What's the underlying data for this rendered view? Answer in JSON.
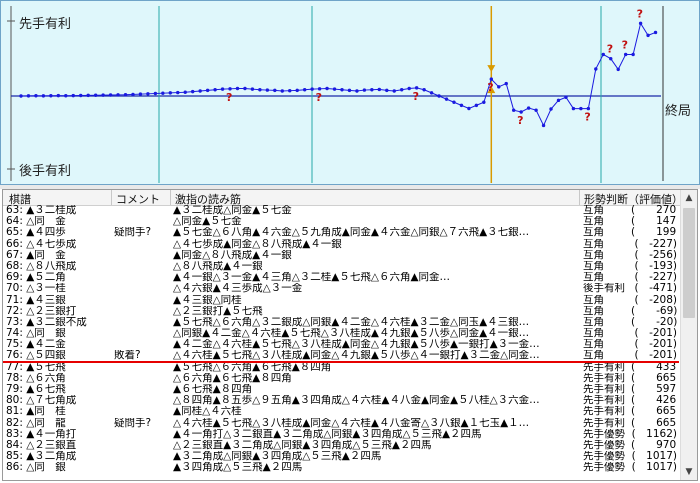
{
  "graph": {
    "top_label": "先手有利",
    "bottom_label": "後手有利",
    "end_label": "終局",
    "colors": {
      "background": "#dff7fb",
      "line": "#1a1ae0",
      "zero_axis": "#1a2aa8",
      "gridline": "#27a9a9",
      "cursor": "#d99a00",
      "question": "#c01010"
    },
    "move_count": 86,
    "current_move": 63,
    "evaluations": [
      0,
      2,
      4,
      2,
      4,
      6,
      4,
      6,
      8,
      10,
      12,
      14,
      16,
      18,
      20,
      25,
      30,
      35,
      40,
      45,
      50,
      55,
      60,
      70,
      80,
      90,
      100,
      110,
      115,
      120,
      120,
      110,
      100,
      95,
      90,
      80,
      85,
      90,
      100,
      110,
      115,
      120,
      110,
      100,
      90,
      80,
      95,
      100,
      105,
      90,
      80,
      100,
      120,
      130,
      100,
      50,
      0,
      -50,
      -100,
      -150,
      -200,
      -150,
      -100,
      270,
      147,
      199,
      -227,
      -256,
      -193,
      -227,
      -471,
      -208,
      -69,
      -20,
      -201,
      -201,
      -201,
      433,
      665,
      597,
      426,
      665,
      665,
      1162,
      970,
      1017
    ],
    "question_moves": [
      28,
      40,
      53,
      63,
      67,
      76,
      79,
      81,
      83
    ]
  },
  "list": {
    "headers": [
      "棋譜",
      "コメント",
      "激指の読み筋",
      "形勢判断（評価値）"
    ],
    "rows": [
      {
        "move": "63: ▲３二桂成",
        "comment": "",
        "reading": "▲３二桂成△同金▲５七金",
        "eval": "互角",
        "value": "(　　270)"
      },
      {
        "move": "64: △同　金",
        "comment": "",
        "reading": "△同金▲５七金",
        "eval": "互角",
        "value": "(　　147)"
      },
      {
        "move": "65: ▲４四歩",
        "comment": "疑問手?",
        "reading": "▲５七金△６八角▲４六金△５九角成▲同金▲４六金△同銀△７六飛▲３七銀…",
        "eval": "互角",
        "value": "(　　199)"
      },
      {
        "move": "66: △４七歩成",
        "comment": "",
        "reading": "△４七歩成▲同金△８八飛成▲４一銀",
        "eval": "互角",
        "value": "(　-227)"
      },
      {
        "move": "67: ▲同　金",
        "comment": "",
        "reading": "▲同金△８八飛成▲４一銀",
        "eval": "互角",
        "value": "(　-256)"
      },
      {
        "move": "68: △８八飛成",
        "comment": "",
        "reading": "△８八飛成▲４一銀",
        "eval": "互角",
        "value": "(　-193)"
      },
      {
        "move": "69: ▲５二角",
        "comment": "",
        "reading": "▲４一銀△３一金▲４三角△３二桂▲５七飛△６六角▲同金…",
        "eval": "互角",
        "value": "(　-227)"
      },
      {
        "move": "70: △３一桂",
        "comment": "",
        "reading": "△４六銀▲４三歩成△３一金",
        "eval": "後手有利",
        "value": "(　-471)"
      },
      {
        "move": "71: ▲４三銀",
        "comment": "",
        "reading": "▲４三銀△同桂",
        "eval": "互角",
        "value": "(　-208)"
      },
      {
        "move": "72: △２三銀打",
        "comment": "",
        "reading": "△２三銀打▲５七飛",
        "eval": "互角",
        "value": "(　　-69)"
      },
      {
        "move": "73: ▲３二銀不成",
        "comment": "",
        "reading": "▲５七飛△６六角△３二銀成△同銀▲４二金△４六桂▲３二金△同玉▲４三銀…",
        "eval": "互角",
        "value": "(　　-20)"
      },
      {
        "move": "74: △同　銀",
        "comment": "",
        "reading": "△同銀▲４二金△４六桂▲５七飛△３八桂成▲４九銀▲５八歩△同金▲４一銀…",
        "eval": "互角",
        "value": "(　-201)"
      },
      {
        "move": "75: ▲４二金",
        "comment": "",
        "reading": "▲４二金△４六桂▲５七飛△３八桂成▲同金△４九銀▲５八歩▲一銀打▲３一金…",
        "eval": "互角",
        "value": "(　-201)"
      },
      {
        "move": "76: △５四銀",
        "comment": "敗着?",
        "reading": "△４六桂▲５七飛△３八桂成▲同金△４九銀▲５八歩△４一銀打▲３二金△同金…",
        "eval": "互角",
        "value": "(　-201)"
      },
      {
        "move": "77: ▲５七飛",
        "comment": "",
        "reading": "▲５七飛△６六角▲６七飛▲８四角",
        "eval": "先手有利",
        "value": "(　　433)"
      },
      {
        "move": "78: △６六角",
        "comment": "",
        "reading": "△６六角▲６七飛▲８四角",
        "eval": "先手有利",
        "value": "(　　665)"
      },
      {
        "move": "79: ▲６七飛",
        "comment": "",
        "reading": "▲６七飛▲８四角",
        "eval": "先手有利",
        "value": "(　　597)"
      },
      {
        "move": "80: △７七角成",
        "comment": "",
        "reading": "△８四角▲８五歩△９五角▲３四角成△４六桂▲４八金▲同金▲５八桂△３六金…",
        "eval": "先手有利",
        "value": "(　　426)"
      },
      {
        "move": "81: ▲同　桂",
        "comment": "",
        "reading": "▲同桂△４六桂",
        "eval": "先手有利",
        "value": "(　　665)"
      },
      {
        "move": "82: △同　龍",
        "comment": "疑問手?",
        "reading": "△４六桂▲５七飛△３八桂成▲同金△４六桂▲４八金寄△３八銀▲１七玉▲１…",
        "eval": "先手有利",
        "value": "(　　665)"
      },
      {
        "move": "83: ▲４一角打",
        "comment": "",
        "reading": "▲４一角打△３二銀直▲３二角成△同銀▲３四角成△５三飛▲２四馬",
        "eval": "先手優勢",
        "value": "(　1162)"
      },
      {
        "move": "84: △２三銀直",
        "comment": "",
        "reading": "△２三銀直▲３二角成△同銀▲３四角成△５三飛▲２四馬",
        "eval": "先手優勢",
        "value": "(　　970)"
      },
      {
        "move": "85: ▲３二角成",
        "comment": "",
        "reading": "▲３二角成△同銀▲３四角成△５三飛▲２四馬",
        "eval": "先手優勢",
        "value": "(　1017)"
      },
      {
        "move": "86: △同　銀",
        "comment": "",
        "reading": "▲３四角成△５三飛▲２四馬",
        "eval": "先手優勢",
        "value": "(　1017)"
      }
    ],
    "selected_row": 13
  }
}
